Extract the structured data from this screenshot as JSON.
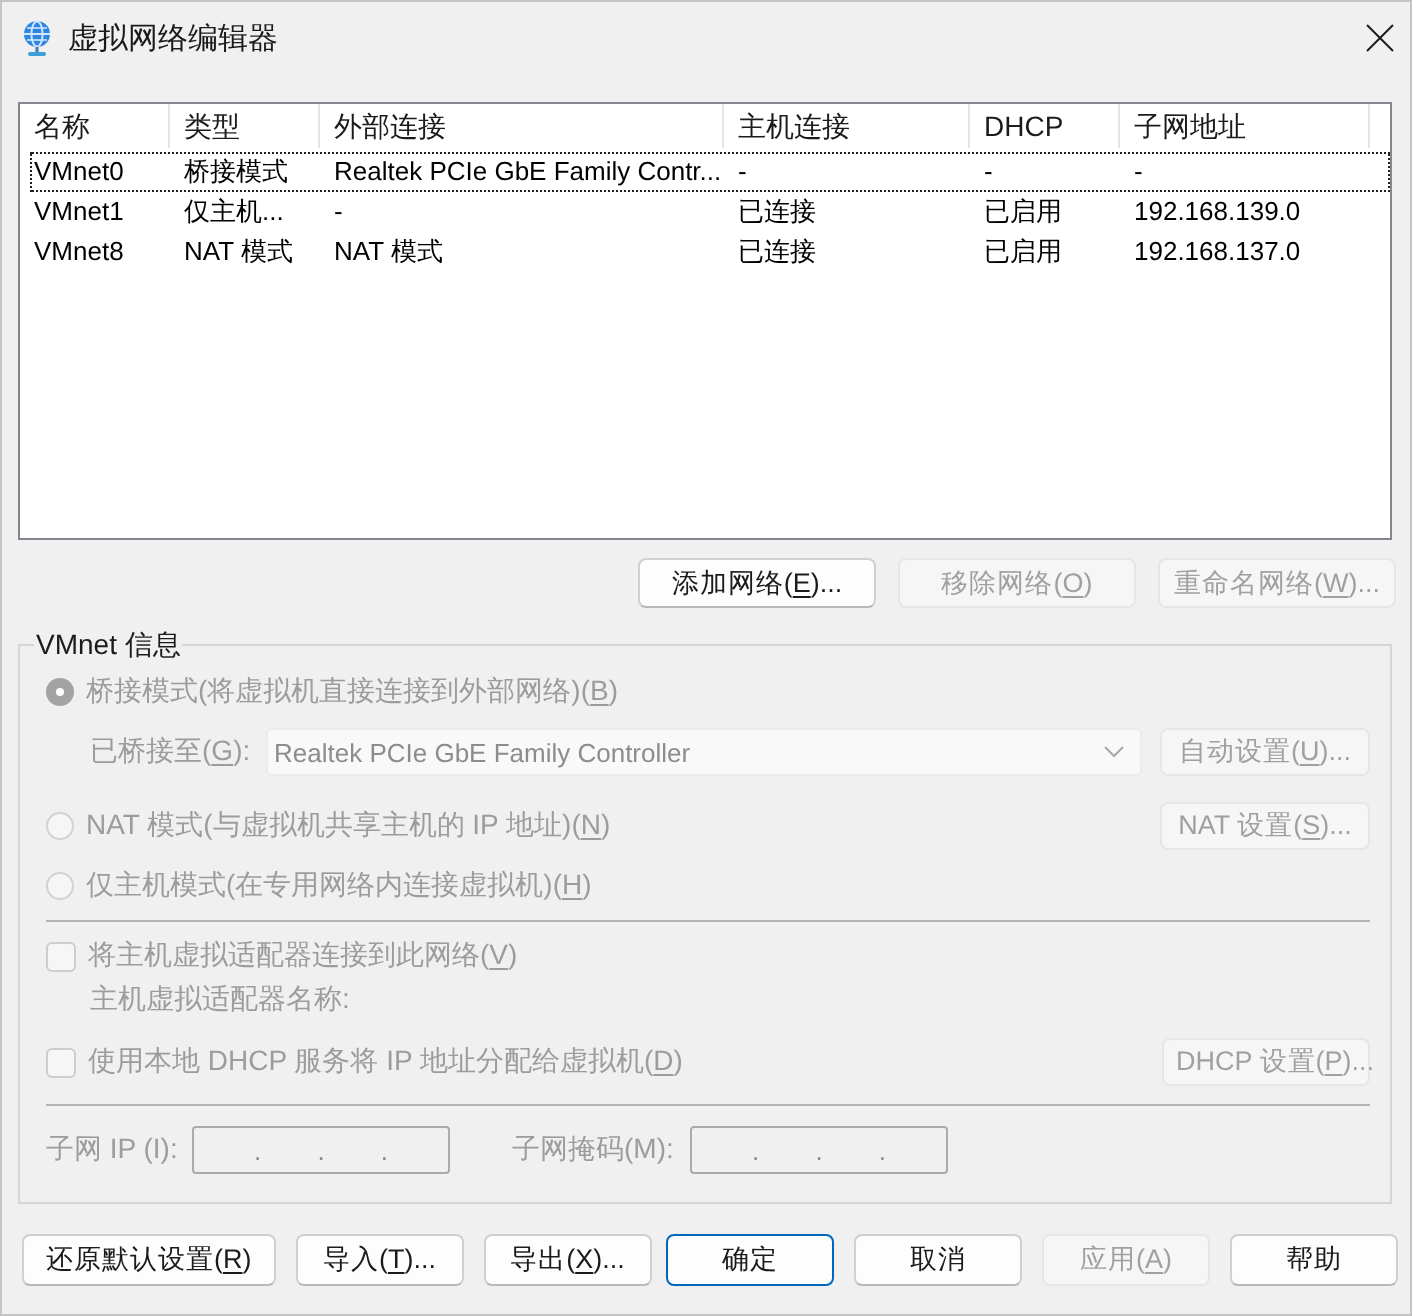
{
  "window": {
    "title": "虚拟网络编辑器"
  },
  "table": {
    "columns": [
      "名称",
      "类型",
      "外部连接",
      "主机连接",
      "DHCP",
      "子网地址"
    ],
    "rows": [
      {
        "cells": [
          "VMnet0",
          "桥接模式",
          "Realtek PCIe GbE Family Contr...",
          "-",
          "-",
          "-"
        ],
        "focused": true
      },
      {
        "cells": [
          "VMnet1",
          "仅主机...",
          "-",
          "已连接",
          "已启用",
          "192.168.139.0"
        ],
        "focused": false
      },
      {
        "cells": [
          "VMnet8",
          "NAT 模式",
          "NAT 模式",
          "已连接",
          "已启用",
          "192.168.137.0"
        ],
        "focused": false
      }
    ]
  },
  "network_buttons": [
    {
      "label": "添加网络",
      "shortcut": "(E)...",
      "disabled": false
    },
    {
      "label": "移除网络",
      "shortcut": "(O)",
      "disabled": true
    },
    {
      "label": "重命名网络",
      "shortcut": "(W)...",
      "disabled": true
    }
  ],
  "vmnet_info": {
    "title": "VMnet 信息",
    "disabled": true,
    "modes": [
      {
        "label": "桥接模式(将虚拟机直接连接到外部网络)",
        "shortcut": "(B)",
        "selected": true,
        "bridged_to": {
          "label": "已桥接至",
          "shortcut": "(G):",
          "value": "Realtek PCIe GbE Family Controller",
          "button": {
            "label": "自动设置",
            "shortcut": "(U)..."
          }
        }
      },
      {
        "label": "NAT 模式(与虚拟机共享主机的 IP 地址)",
        "shortcut": "(N)",
        "selected": false,
        "button": {
          "label": "NAT 设置",
          "shortcut": "(S)..."
        }
      },
      {
        "label": "仅主机模式(在专用网络内连接虚拟机)",
        "shortcut": "(H)",
        "selected": false
      }
    ],
    "host_adapter": {
      "label": "将主机虚拟适配器连接到此网络",
      "shortcut": "(V)",
      "checked": false,
      "name_label": "主机虚拟适配器名称:"
    },
    "dhcp": {
      "label": "使用本地 DHCP 服务将 IP 地址分配给虚拟机",
      "shortcut": "(D)",
      "checked": false,
      "button": {
        "label": "DHCP 设置",
        "shortcut": "(P)..."
      }
    },
    "subnet_ip": {
      "label": "子网 IP (I):",
      "separator": "."
    },
    "subnet_mask": {
      "label": "子网掩码(M):",
      "separator": "."
    }
  },
  "footer": {
    "left_buttons": [
      {
        "label": "还原默认设置",
        "shortcut": "(R)",
        "disabled": false,
        "default": false
      },
      {
        "label": "导入",
        "shortcut": "(T)...",
        "disabled": false,
        "default": false
      },
      {
        "label": "导出",
        "shortcut": "(X)...",
        "disabled": false,
        "default": false
      }
    ],
    "right_buttons": [
      {
        "label": "确定",
        "disabled": false,
        "default": true
      },
      {
        "label": "取消",
        "disabled": false,
        "default": false
      },
      {
        "label": "应用",
        "shortcut": "(A)",
        "disabled": true,
        "default": false
      },
      {
        "label": "帮助",
        "disabled": false,
        "default": false
      }
    ]
  }
}
